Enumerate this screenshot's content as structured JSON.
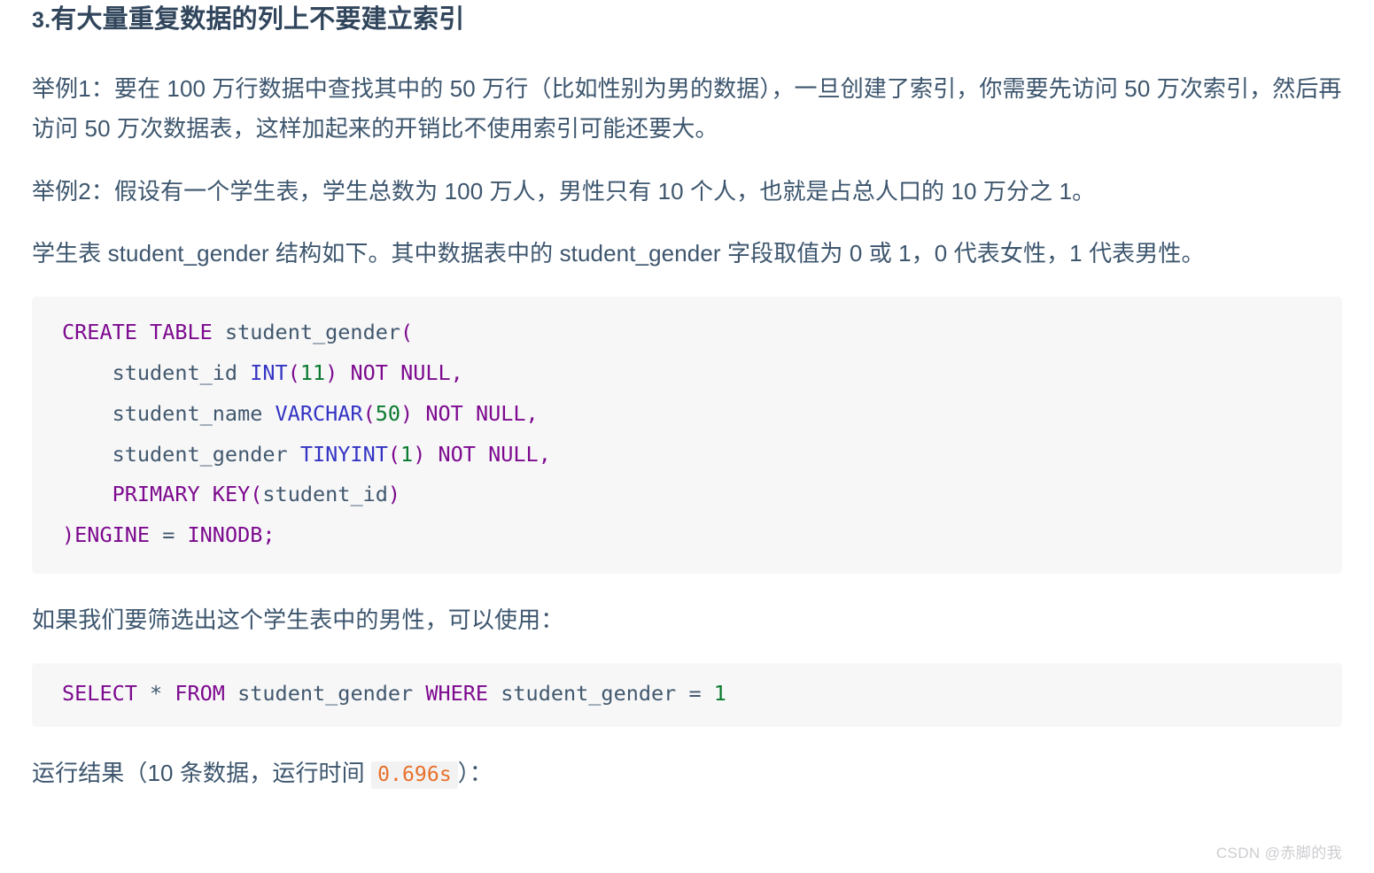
{
  "document": {
    "heading": {
      "number": "3.",
      "text": "有大量重复数据的列上不要建立索引"
    },
    "paragraphs": {
      "example1": "举例1：要在 100 万行数据中查找其中的 50 万行（比如性别为男的数据），一旦创建了索引，你需要先访问 50 万次索引，然后再访问 50 万次数据表，这样加起来的开销比不使用索引可能还要大。",
      "example2": "举例2：假设有一个学生表，学生总数为 100 万人，男性只有 10 个人，也就是占总人口的 10 万分之 1。",
      "structure": "学生表 student_gender 结构如下。其中数据表中的 student_gender 字段取值为 0 或 1，0 代表女性，1 代表男性。",
      "filter": "如果我们要筛选出这个学生表中的男性，可以使用：",
      "result_prefix": "运行结果（10 条数据，运行时间 ",
      "result_time": "0.696s",
      "result_suffix": "）："
    },
    "code_blocks": {
      "create_table": {
        "language": "sql",
        "plain_text": "CREATE TABLE student_gender(\n    student_id INT(11) NOT NULL,\n    student_name VARCHAR(50) NOT NULL,\n    student_gender TINYINT(1) NOT NULL,\n    PRIMARY KEY(student_id)\n)ENGINE = INNODB;",
        "lines": [
          "CREATE TABLE student_gender(",
          "    student_id INT(11) NOT NULL,",
          "    student_name VARCHAR(50) NOT NULL,",
          "    student_gender TINYINT(1) NOT NULL,",
          "    PRIMARY KEY(student_id)",
          ")ENGINE = INNODB;"
        ],
        "table_name": "student_gender",
        "columns": [
          {
            "name": "student_id",
            "type": "INT(11)",
            "constraint": "NOT NULL"
          },
          {
            "name": "student_name",
            "type": "VARCHAR(50)",
            "constraint": "NOT NULL"
          },
          {
            "name": "student_gender",
            "type": "TINYINT(1)",
            "constraint": "NOT NULL"
          }
        ],
        "primary_key": "student_id",
        "engine": "INNODB"
      },
      "select_query": {
        "language": "sql",
        "plain_text": "SELECT * FROM student_gender WHERE student_gender = 1"
      }
    },
    "watermark": "CSDN @赤脚的我",
    "colors": {
      "text": "#3d566e",
      "heading": "#31465c",
      "code_bg": "#f7f7f8",
      "keyword": "#7d0a8f",
      "type": "#3434c4",
      "number": "#0a7a2f",
      "identifier": "#41586e",
      "inline_code_text": "#e8702a",
      "inline_code_bg": "#f2f2f3",
      "watermark": "#cdcdd1"
    }
  }
}
